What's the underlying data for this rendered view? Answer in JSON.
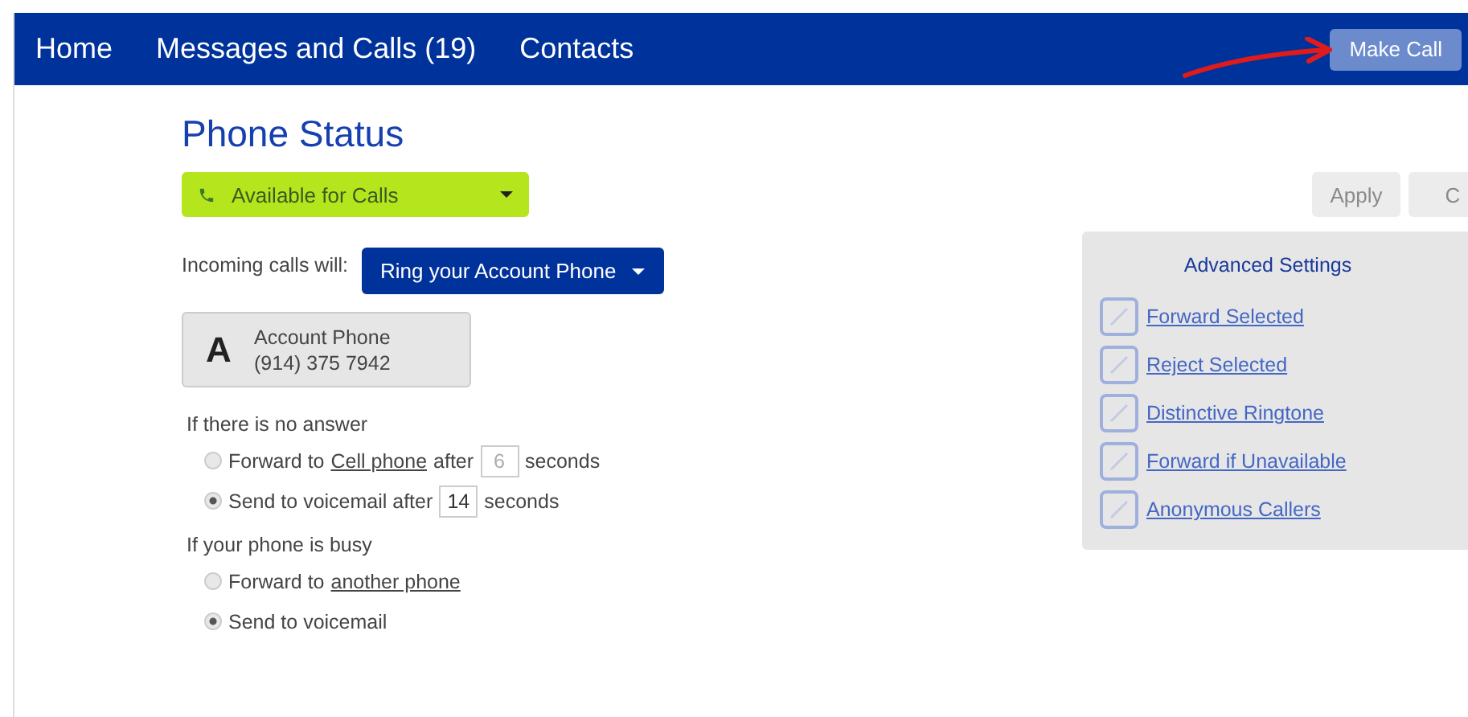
{
  "nav": {
    "items": [
      {
        "label": "Home"
      },
      {
        "label": "Messages and Calls (19)"
      },
      {
        "label": "Contacts"
      }
    ],
    "make_call": "Make Call"
  },
  "title": "Phone Status",
  "status": {
    "label": "Available for Calls"
  },
  "incoming": {
    "label": "Incoming calls will:",
    "value": "Ring your Account Phone"
  },
  "account": {
    "letter": "A",
    "name": "Account Phone",
    "number": "(914) 375 7942"
  },
  "groups": [
    {
      "heading": "If there is no answer",
      "options": [
        {
          "selected": false,
          "text": "Forward to",
          "link": "Cell phone",
          "after": "after",
          "seconds": "6",
          "suffix": "seconds"
        },
        {
          "selected": true,
          "text": "Send to voicemail after",
          "seconds": "14",
          "suffix": "seconds"
        }
      ]
    },
    {
      "heading": "If your phone is busy",
      "options": [
        {
          "selected": false,
          "text": "Forward to",
          "link": "another phone"
        },
        {
          "selected": true,
          "text": "Send to voicemail"
        }
      ]
    }
  ],
  "actions": [
    {
      "label": "Apply",
      "disabled": true
    },
    {
      "label": "C",
      "disabled": true
    }
  ],
  "advanced": {
    "title": "Advanced Settings",
    "links": [
      {
        "label": "Forward Selected"
      },
      {
        "label": "Reject Selected"
      },
      {
        "label": "Distinctive Ringtone"
      },
      {
        "label": "Forward if Unavailable"
      },
      {
        "label": "Anonymous Callers"
      }
    ]
  }
}
